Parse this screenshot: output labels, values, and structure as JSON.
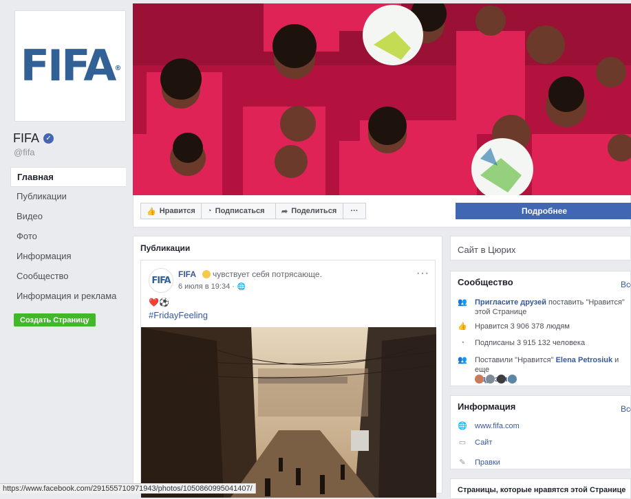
{
  "profile": {
    "logo_text": "FIFA",
    "name": "FIFA",
    "handle": "@fifa"
  },
  "nav": {
    "items": [
      {
        "label": "Главная",
        "active": true
      },
      {
        "label": "Публикации"
      },
      {
        "label": "Видео"
      },
      {
        "label": "Фото"
      },
      {
        "label": "Информация"
      },
      {
        "label": "Сообщество"
      },
      {
        "label": "Информация и реклама"
      }
    ],
    "create_page": "Создать Страницу"
  },
  "actions": {
    "like": "Нравится",
    "follow": "Подписаться",
    "share": "Поделиться",
    "more": "···",
    "learn_more": "Подробнее"
  },
  "posts": {
    "title": "Публикации",
    "post": {
      "avatar_text": "FIFA",
      "author": "FIFA",
      "feeling": "чувствует себя потрясающе.",
      "time": "6 июля в 19:34 ·",
      "menu": "···",
      "emojis": "❤️⚽",
      "hashtag": "#FridayFeeling"
    }
  },
  "right": {
    "location": "Сайт в Цюрих",
    "community": {
      "title": "Сообщество",
      "see_all": "Все",
      "invite_link": "Пригласите друзей",
      "invite_rest": " поставить \"Нравится\" этой Странице",
      "likes": "Нравится 3 906 378 людям",
      "followers": "Подписаны 3 915 132 человека",
      "friends_prefix": "Поставили \"Нравится\" ",
      "friend_name": "Elena Petrosiuk",
      "friends_mid": " и еще",
      "friends_count": "3 друзьям"
    },
    "info": {
      "title": "Информация",
      "see_all": "Все",
      "website": "www.fifa.com",
      "site": "Сайт",
      "edits": "Правки"
    },
    "liked_pages": {
      "title": "Страницы, которые нравятся этой Странице"
    }
  },
  "status_bar": {
    "url": "https://www.facebook.com/291555710971943/photos/1050860995041407/"
  },
  "colors": {
    "fb_blue": "#4267b2",
    "link": "#365899",
    "green": "#42b72a",
    "fifa_blue": "#326295",
    "jersey": "#d81b4a"
  },
  "icons": [
    "verified-badge-icon",
    "thumbs-up-icon",
    "rss-icon",
    "share-arrow-icon",
    "globe-icon",
    "window-icon",
    "pencil-icon",
    "people-icon"
  ]
}
